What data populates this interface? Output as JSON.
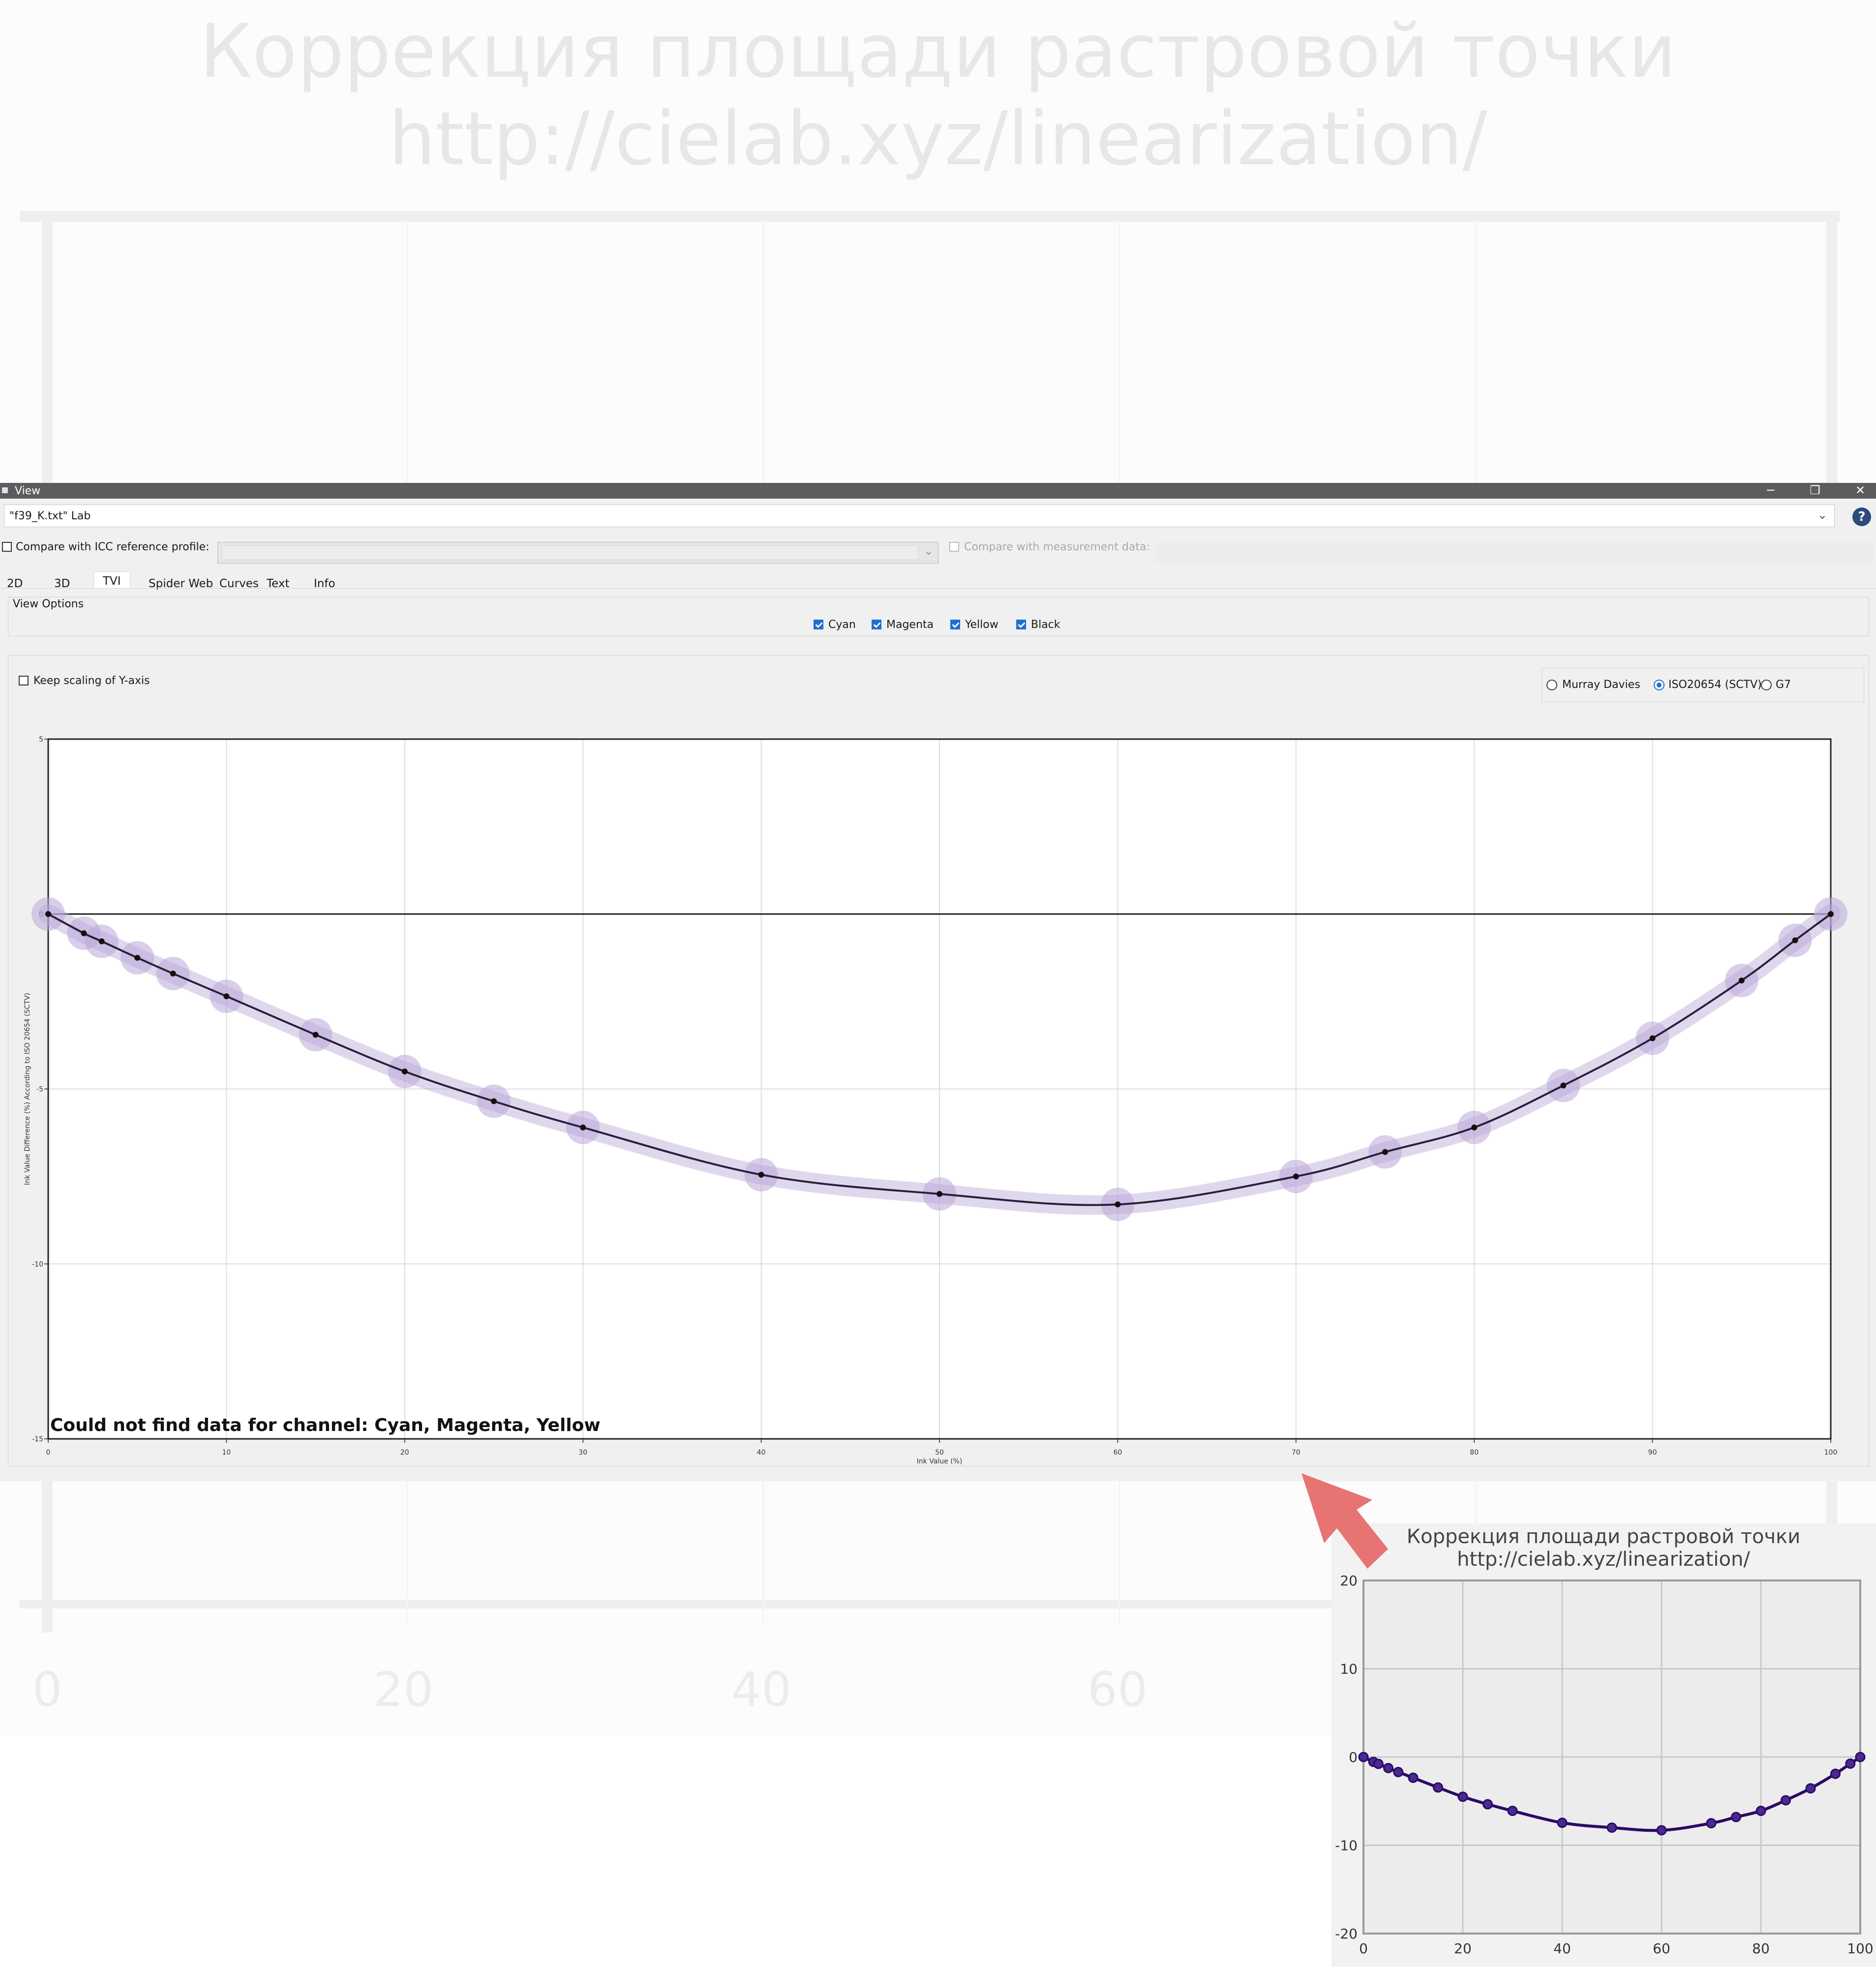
{
  "watermark": {
    "title_line1": "Коррекция площади растровой точки",
    "title_line2": "http://cielab.xyz/linearization/",
    "x_ticks": [
      "0",
      "20",
      "40",
      "60"
    ]
  },
  "window": {
    "title": "View",
    "buttons": {
      "minimize": "─",
      "maximize": "❐",
      "close": "✕"
    },
    "file_select_value": "\"f39_K.txt\" Lab",
    "help_label": "?",
    "compare_icc_label": "Compare with ICC reference profile:",
    "compare_measurement_label": "Compare with measurement data:",
    "tabs": [
      "2D",
      "3D",
      "TVI",
      "Spider Web",
      "Curves",
      "Text",
      "Info"
    ],
    "active_tab": "TVI",
    "view_options_label": "View Options",
    "channels": [
      {
        "label": "Cyan",
        "checked": true
      },
      {
        "label": "Magenta",
        "checked": true
      },
      {
        "label": "Yellow",
        "checked": true
      },
      {
        "label": "Black",
        "checked": true
      }
    ],
    "keep_scaling_label": "Keep scaling of Y-axis",
    "tvi_methods": [
      {
        "label": "Murray Davies",
        "selected": false
      },
      {
        "label": "ISO20654 (SCTV)",
        "selected": true
      },
      {
        "label": "G7",
        "selected": false
      }
    ],
    "no_data_message": "Could not find data for channel: Cyan, Magenta, Yellow"
  },
  "colors": {
    "curve": "#2a1e3a",
    "halo": "#b9a8d8",
    "inset_curve": "#2a0a66",
    "arrow": "#e87373"
  },
  "chart_data": [
    {
      "type": "line",
      "xlabel": "Ink Value (%)",
      "ylabel": "Ink Value Difference (%) According to ISO 20654 (SCTV)",
      "xlim": [
        0,
        100
      ],
      "ylim": [
        -15,
        5
      ],
      "x_ticks": [
        "0",
        "10",
        "20",
        "30",
        "40",
        "50",
        "60",
        "70",
        "80",
        "90",
        "100"
      ],
      "y_ticks": [
        "5",
        "0",
        "-5",
        "-10",
        "-15"
      ],
      "grid": true,
      "series": [
        {
          "name": "Black",
          "x": [
            0,
            2,
            3,
            5,
            7,
            10,
            15,
            20,
            25,
            30,
            40,
            50,
            60,
            70,
            75,
            80,
            85,
            90,
            95,
            98,
            100
          ],
          "y": [
            0,
            -0.55,
            -0.78,
            -1.25,
            -1.7,
            -2.35,
            -3.45,
            -4.5,
            -5.35,
            -6.1,
            -7.45,
            -8.0,
            -8.3,
            -7.5,
            -6.8,
            -6.1,
            -4.9,
            -3.55,
            -1.9,
            -0.75,
            0
          ]
        }
      ]
    },
    {
      "type": "line",
      "title": "Коррекция площади растровой точки\nhttp://cielab.xyz/linearization/",
      "xlim": [
        0,
        100
      ],
      "ylim": [
        -20,
        20
      ],
      "x_ticks": [
        "0",
        "20",
        "40",
        "60",
        "80",
        "100"
      ],
      "y_ticks": [
        "20",
        "10",
        "0",
        "-10",
        "-20"
      ],
      "grid": true,
      "series": [
        {
          "x": [
            0,
            2,
            3,
            5,
            7,
            10,
            15,
            20,
            25,
            30,
            40,
            50,
            60,
            70,
            75,
            80,
            85,
            90,
            95,
            98,
            100
          ],
          "y": [
            0,
            -0.55,
            -0.78,
            -1.25,
            -1.7,
            -2.35,
            -3.45,
            -4.5,
            -5.35,
            -6.1,
            -7.45,
            -8.0,
            -8.3,
            -7.5,
            -6.8,
            -6.1,
            -4.9,
            -3.55,
            -1.9,
            -0.75,
            0
          ]
        }
      ]
    }
  ]
}
